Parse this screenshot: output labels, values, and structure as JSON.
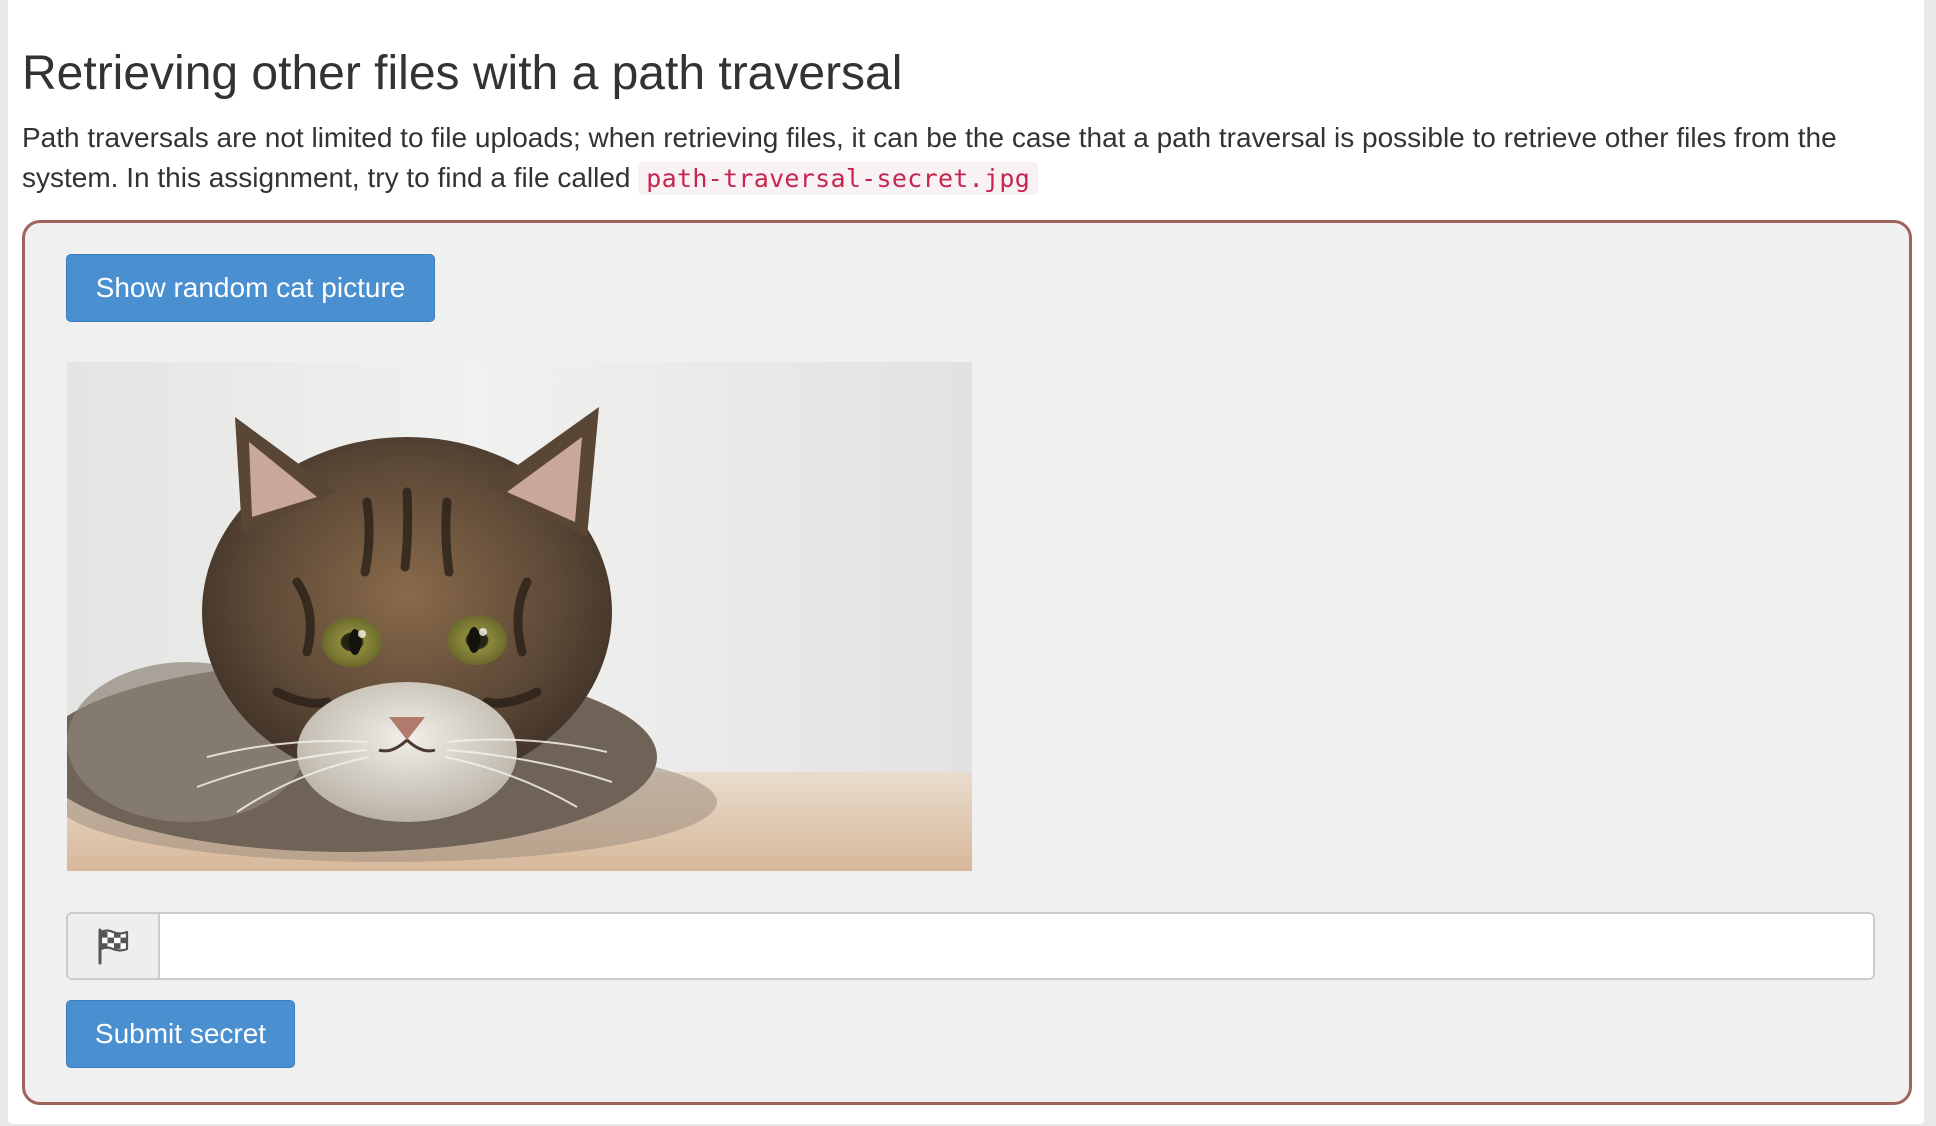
{
  "lesson": {
    "title": "Retrieving other files with a path traversal",
    "intro_text": "Path traversals are not limited to file uploads; when retrieving files, it can be the case that a path traversal is possible to retrieve other files from the system. In this assignment, try to find a file called",
    "target_file": "path-traversal-secret.jpg"
  },
  "assignment": {
    "random_cat_button_label": "Show random cat picture",
    "cat_image_icon": "cat-photo",
    "flag_icon": "checkered-flag-icon",
    "secret_input_value": "",
    "secret_input_placeholder": "",
    "submit_button_label": "Submit secret"
  },
  "colors": {
    "button_primary": "#4a8fd0",
    "panel_border": "#a0625c",
    "panel_background": "#f0f0f0",
    "code_text": "#c7254e",
    "code_background": "#f9f2f4"
  }
}
